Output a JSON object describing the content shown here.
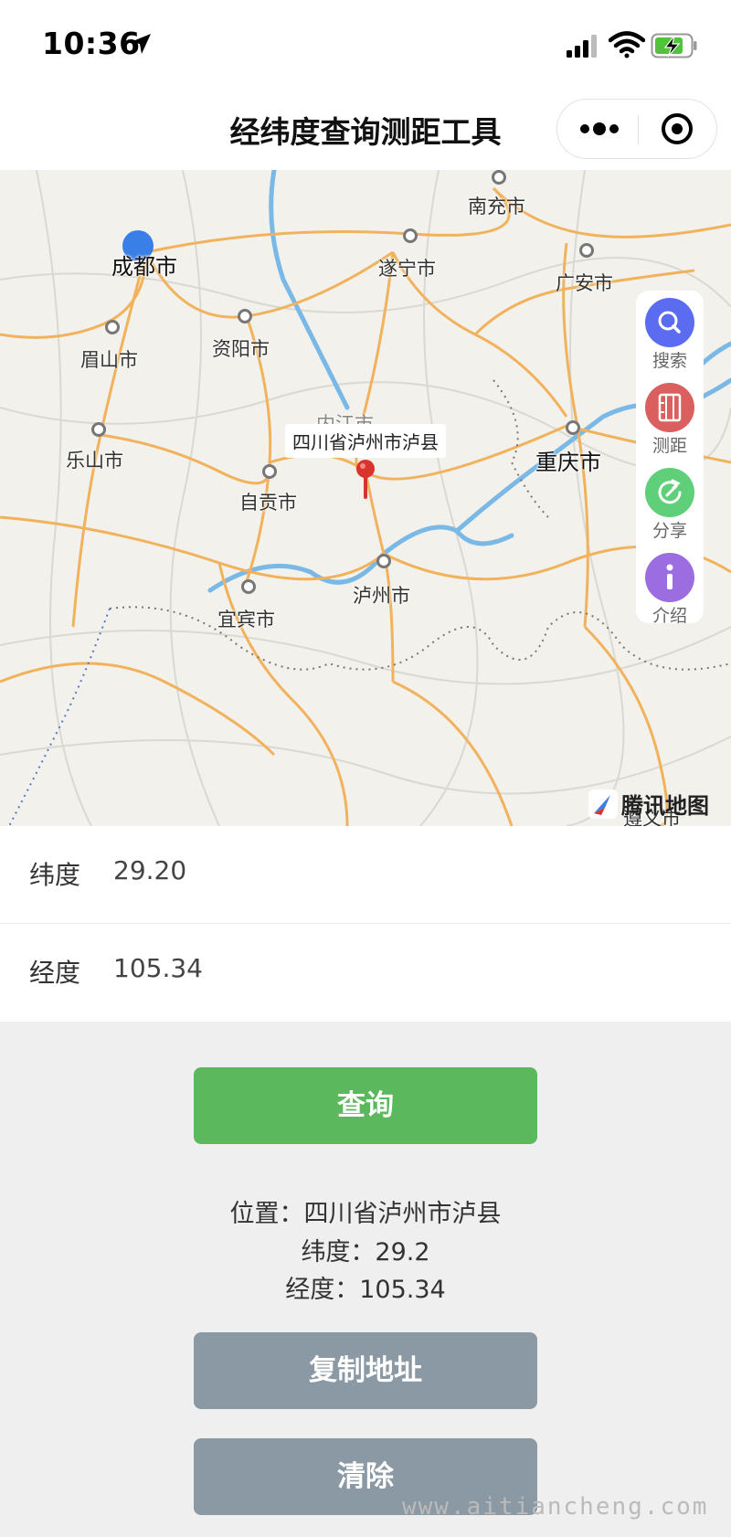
{
  "status_bar": {
    "time": "10:36",
    "icons": [
      "location-arrow-icon",
      "cellular-signal-icon",
      "wifi-icon",
      "battery-charging-icon"
    ]
  },
  "nav": {
    "title": "经纬度查询测距工具",
    "capsule_icons": [
      "more-dots-icon",
      "close-target-icon"
    ]
  },
  "map": {
    "cities": [
      "南充市",
      "成都市",
      "遂宁市",
      "广安市",
      "眉山市",
      "资阳市",
      "内江市",
      "乐山市",
      "重庆市",
      "自贡市",
      "泸州市",
      "宜宾市",
      "遵义市"
    ],
    "callout": "四川省泸州市泸县",
    "provider": "腾讯地图",
    "colors": {
      "road": "#f2b25c",
      "river": "#7ab8e6",
      "pin": "#d9342b",
      "user_location": "#3a7ee8"
    }
  },
  "toolbar": {
    "items": [
      {
        "label": "搜索",
        "icon": "search-icon",
        "color": "#5b6cf0"
      },
      {
        "label": "测距",
        "icon": "ruler-icon",
        "color": "#d9605e"
      },
      {
        "label": "分享",
        "icon": "share-icon",
        "color": "#5fcf7a"
      },
      {
        "label": "介绍",
        "icon": "info-icon",
        "color": "#9b6de0"
      }
    ]
  },
  "form": {
    "latitude_label": "纬度",
    "latitude_value": "29.20",
    "longitude_label": "经度",
    "longitude_value": "105.34"
  },
  "actions": {
    "query_label": "查询",
    "copy_label": "复制地址",
    "clear_label": "清除",
    "colors": {
      "query": "#5cb85c",
      "secondary": "#8a99a3"
    }
  },
  "result": {
    "location": "位置：四川省泸州市泸县",
    "latitude": "纬度：29.2",
    "longitude": "经度：105.34"
  },
  "watermark": "www.aitiancheng.com"
}
